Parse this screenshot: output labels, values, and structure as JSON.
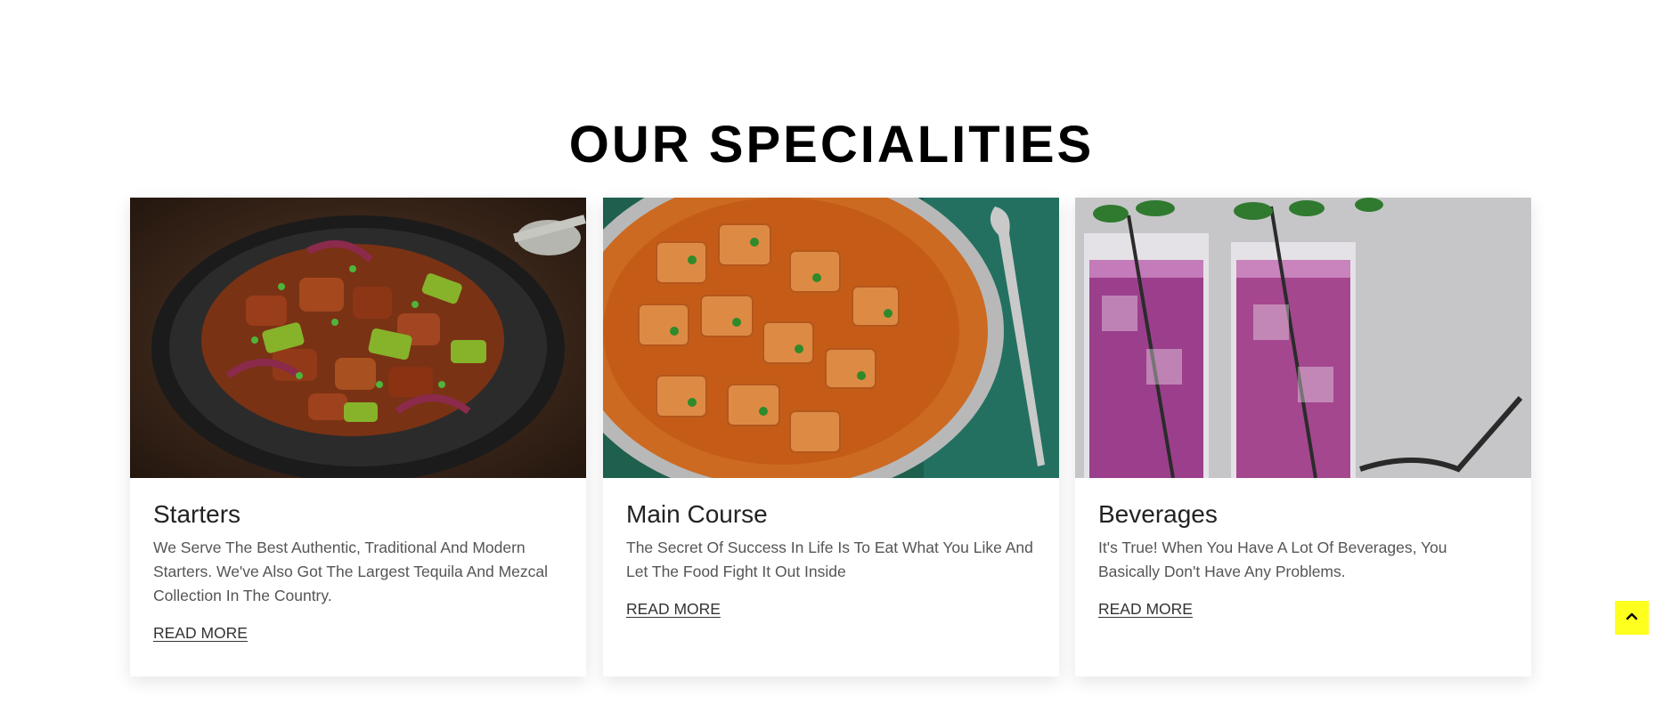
{
  "section": {
    "title": "OUR SPECIALITIES"
  },
  "cards": [
    {
      "title": "Starters",
      "text": "We Serve The Best Authentic, Traditional And Modern Starters. We've Also Got The Largest Tequila And Mezcal Collection In The Country.",
      "link": "READ MORE",
      "image": "chilli-paneer-dish-image"
    },
    {
      "title": "Main Course",
      "text": "The Secret Of Success In Life Is To Eat What You Like And Let The Food Fight It Out Inside",
      "link": "READ MORE",
      "image": "paneer-curry-image"
    },
    {
      "title": "Beverages",
      "text": "It's True! When You Have A Lot Of Beverages, You Basically Don't Have Any Problems.",
      "link": "READ MORE",
      "image": "purple-drinks-image"
    }
  ],
  "scroll_top": {
    "icon": "chevron-up-icon",
    "color": "#ffff1e"
  }
}
